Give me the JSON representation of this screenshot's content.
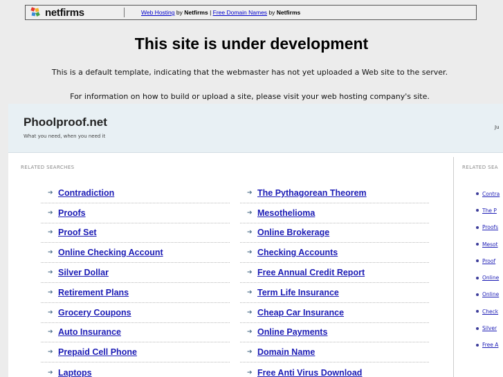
{
  "netfirms_bar": {
    "logo_text": "netfirms",
    "links": [
      {
        "link": "Web Hosting",
        "by": " by ",
        "brand": "Netfirms",
        "sep": " | "
      },
      {
        "link": "Free Domain Names",
        "by": " by ",
        "brand": "Netfirms",
        "sep": ""
      }
    ],
    "logo_colors": [
      "#e63a2e",
      "#f4b324",
      "#3a8bd6",
      "#44a046"
    ]
  },
  "title": "This site is under development",
  "info_lines": [
    "This is a default template, indicating that the webmaster has not yet uploaded a Web site to the server.",
    "For information on how to build or upload a site, please visit your web hosting company's site."
  ],
  "parked": {
    "site_name": "Phoolproof.net",
    "tagline": "What you need, when you need it",
    "header_right": "Ju",
    "related_heading": "RELATED SEARCHES",
    "side_heading": "RELATED SEA",
    "col1": [
      "Contradiction",
      "Proofs",
      "Proof Set",
      "Online Checking Account",
      "Silver Dollar",
      "Retirement Plans",
      "Grocery Coupons",
      "Auto Insurance",
      "Prepaid Cell Phone",
      "Laptops"
    ],
    "col2": [
      "The Pythagorean Theorem",
      "Mesothelioma",
      "Online Brokerage",
      "Checking Accounts",
      "Free Annual Credit Report",
      "Term Life Insurance",
      "Cheap Car Insurance",
      "Online Payments",
      "Domain Name",
      "Free Anti Virus Download"
    ],
    "side": [
      "Contra",
      "The P",
      "Proofs",
      "Mesot",
      "Proof",
      "Online",
      "Online",
      "Check",
      "Silver",
      "Free A"
    ],
    "colors": {
      "link": "#1b1bb5",
      "header_bg": "#e8f0f4"
    }
  }
}
